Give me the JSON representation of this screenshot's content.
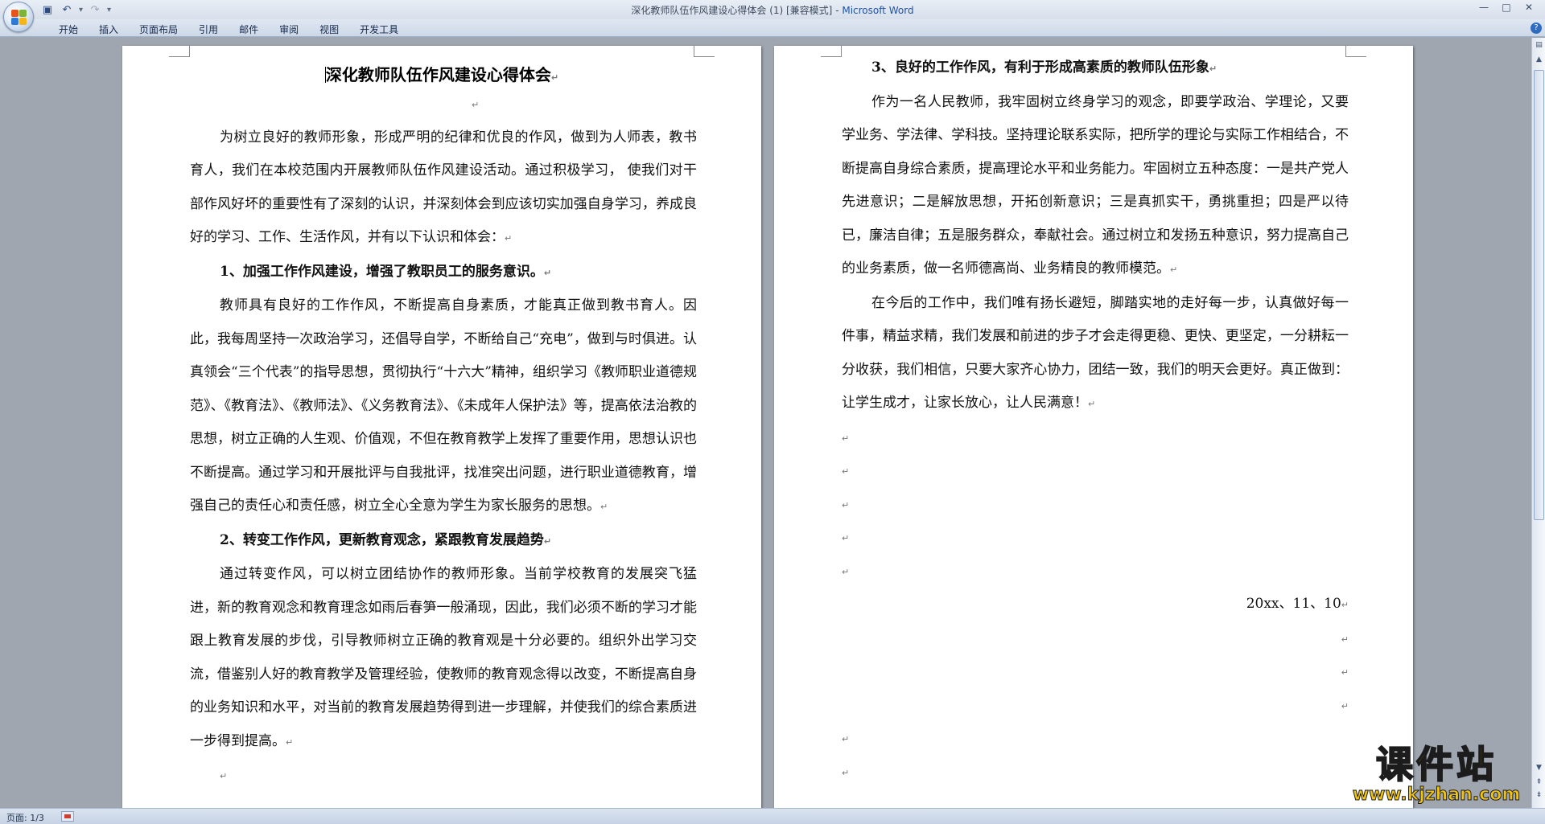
{
  "window": {
    "title_document": "深化教师队伍作风建设心得体会 (1) [兼容模式]",
    "title_separator": " - ",
    "title_app": "Microsoft Word",
    "minimize": "—",
    "maximize": "□",
    "close": "✕"
  },
  "quick_access": {
    "save_icon": "save-icon",
    "undo_icon": "undo-icon",
    "redo_icon": "redo-icon",
    "customize_icon": "chevron-down-icon"
  },
  "ribbon": {
    "tabs": [
      "开始",
      "插入",
      "页面布局",
      "引用",
      "邮件",
      "审阅",
      "视图",
      "开发工具"
    ],
    "help": "?"
  },
  "colors": {
    "accent": "#1f52a5",
    "watermark_fill": "#f2c40c",
    "watermark_outline": "#1c1c1c"
  },
  "paragraph_mark": "↵",
  "page_left": {
    "title": "深化教师队伍作风建设心得体会",
    "para1": "为树立良好的教师形象，形成严明的纪律和优良的作风，做到为人师表，教书育人，我们在本校范围内开展教师队伍作风建设活动。通过积极学习， 使我们对干部作风好坏的重要性有了深刻的认识，并深刻体会到应该切实加强自身学习，养成良好的学习、工作、生活作风，并有以下认识和体会：",
    "heading1": "1、加强工作作风建设，增强了教职员工的服务意识。",
    "para2": "教师具有良好的工作作风，不断提高自身素质，才能真正做到教书育人。因此，我每周坚持一次政治学习，还倡导自学，不断给自己“充电”，做到与时俱进。认真领会“三个代表”的指导思想，贯彻执行“十六大”精神，组织学习《教师职业道德规范》、《教育法》、《教师法》、《义务教育法》、《未成年人保护法》等，提高依法治教的思想，树立正确的人生观、价值观，不但在教育教学上发挥了重要作用，思想认识也不断提高。通过学习和开展批评与自我批评，找准突出问题，进行职业道德教育，增强自己的责任心和责任感，树立全心全意为学生为家长服务的思想。",
    "heading2": "2、转变工作作风，更新教育观念，紧跟教育发展趋势",
    "para3": "通过转变作风，可以树立团结协作的教师形象。当前学校教育的发展突飞猛进，新的教育观念和教育理念如雨后春笋一般涌现，因此，我们必须不断的学习才能跟上教育发展的步伐，引导教师树立正确的教育观是十分必要的。组织外出学习交流，借鉴别人好的教育教学及管理经验，使教师的教育观念得以改变，不断提高自身的业务知识和水平，对当前的教育发展趋势得到进一步理解，并使我们的综合素质进一步得到提高。"
  },
  "page_right": {
    "heading3": "3、良好的工作作风，有利于形成高素质的教师队伍形象",
    "para4": "作为一名人民教师，我牢固树立终身学习的观念，即要学政治、学理论，又要学业务、学法律、学科技。坚持理论联系实际，把所学的理论与实际工作相结合，不断提高自身综合素质，提高理论水平和业务能力。牢固树立五种态度：一是共产党人先进意识；二是解放思想，开拓创新意识；三是真抓实干，勇挑重担；四是严以待已，廉洁自律；五是服务群众，奉献社会。通过树立和发扬五种意识，努力提高自己的业务素质，做一名师德高尚、业务精良的教师模范。",
    "para5": "在今后的工作中，我们唯有扬长避短，脚踏实地的走好每一步，认真做好每一件事，精益求精，我们发展和前进的步子才会走得更稳、更快、更坚定，一分耕耘一分收获，我们相信，只要大家齐心协力，团结一致，我们的明天会更好。真正做到：让学生成才，让家长放心，让人民满意！",
    "date": "20xx、11、10"
  },
  "status_bar": {
    "page_info": "页面: 1/3"
  },
  "watermark": {
    "name": "课件站",
    "url": "www.kjzhan.com"
  }
}
